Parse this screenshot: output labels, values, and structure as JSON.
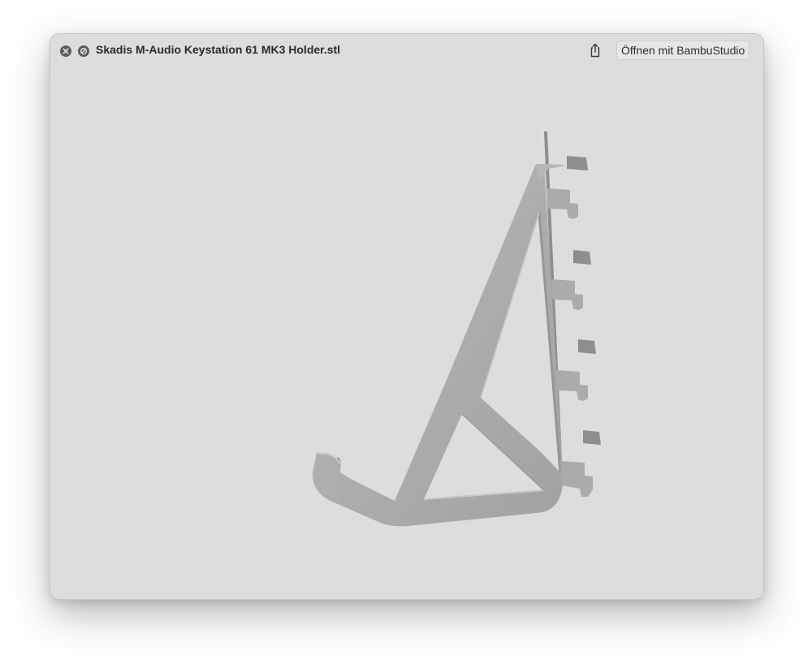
{
  "window": {
    "title": "Skadis M-Audio Keystation 61 MK3 Holder.stl",
    "open_with_label": "Öffnen mit BambuStudio"
  },
  "icons": {
    "close": "close-icon",
    "no_fullscreen": "no-fullscreen-icon",
    "share": "share-icon"
  },
  "colors": {
    "window_bg": "#dddcde",
    "model_light": "#b4b4b4",
    "model_face": "#a7a7a7",
    "model_shadow": "#8f8f8f"
  }
}
